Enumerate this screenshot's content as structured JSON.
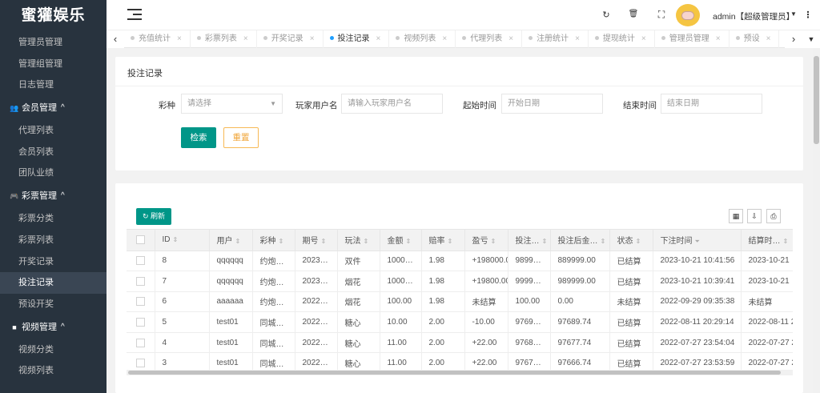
{
  "app": {
    "logo": "蜜獾娱乐"
  },
  "sidebar": {
    "items": [
      {
        "type": "item",
        "label": "管理员管理"
      },
      {
        "type": "item",
        "label": "管理组管理"
      },
      {
        "type": "item",
        "label": "日志管理"
      },
      {
        "type": "group",
        "label": "会员管理",
        "icon": "users-icon",
        "glyph": "👥"
      },
      {
        "type": "item",
        "label": "代理列表"
      },
      {
        "type": "item",
        "label": "会员列表"
      },
      {
        "type": "item",
        "label": "团队业绩"
      },
      {
        "type": "group",
        "label": "彩票管理",
        "icon": "gamepad-icon",
        "glyph": "🎮"
      },
      {
        "type": "item",
        "label": "彩票分类"
      },
      {
        "type": "item",
        "label": "彩票列表"
      },
      {
        "type": "item",
        "label": "开奖记录"
      },
      {
        "type": "item",
        "label": "投注记录",
        "active": true
      },
      {
        "type": "item",
        "label": "预设开奖"
      },
      {
        "type": "group",
        "label": "视频管理",
        "icon": "video-icon",
        "glyph": "■"
      },
      {
        "type": "item",
        "label": "视频分类"
      },
      {
        "type": "item",
        "label": "视频列表"
      }
    ]
  },
  "header": {
    "user": "admin【超级管理员】",
    "icons": [
      "refresh-icon",
      "trash-icon",
      "fullscreen-icon",
      "dropdown-icon",
      "more-icon"
    ]
  },
  "tabs": [
    {
      "label": "充值统计"
    },
    {
      "label": "彩票列表"
    },
    {
      "label": "开奖记录"
    },
    {
      "label": "投注记录",
      "active": true
    },
    {
      "label": "视频列表"
    },
    {
      "label": "代理列表"
    },
    {
      "label": "注册统计"
    },
    {
      "label": "提现统计"
    },
    {
      "label": "管理员管理"
    },
    {
      "label": "预设"
    }
  ],
  "filter": {
    "title": "投注记录",
    "lottery_label": "彩种",
    "lottery_placeholder": "请选择",
    "player_label": "玩家用户名",
    "player_placeholder": "请输入玩家用户名",
    "start_label": "起始时间",
    "start_placeholder": "开始日期",
    "end_label": "结束时间",
    "end_placeholder": "结束日期",
    "search_button": "检索",
    "reset_button": "重置"
  },
  "table": {
    "refresh_label": "刷新",
    "columns": [
      "ID",
      "用户",
      "彩种",
      "期号",
      "玩法",
      "金额",
      "赔率",
      "盈亏",
      "投注…",
      "投注后金…",
      "状态",
      "下注时间",
      "结算时…"
    ],
    "rows": [
      {
        "id": "8",
        "user": "qqqqqq",
        "lottery": "约炮…",
        "issue": "2023…",
        "play": "双件",
        "amount": "1000…",
        "odds": "1.98",
        "profit": "+198000.0",
        "profit_color": "green",
        "before": "9899…",
        "after": "889999.00",
        "status": "已结算",
        "status_color": "green",
        "bet_time": "2023-10-21 10:41:56",
        "settle_time": "2023-10-21",
        "settle_color": "green"
      },
      {
        "id": "7",
        "user": "qqqqqq",
        "lottery": "约炮…",
        "issue": "2023…",
        "play": "烟花",
        "amount": "1000…",
        "odds": "1.98",
        "profit": "+19800.00",
        "profit_color": "green",
        "before": "9999…",
        "after": "989999.00",
        "status": "已结算",
        "status_color": "green",
        "bet_time": "2023-10-21 10:39:41",
        "settle_time": "2023-10-21",
        "settle_color": "green"
      },
      {
        "id": "6",
        "user": "aaaaaa",
        "lottery": "约炮…",
        "issue": "2022…",
        "play": "烟花",
        "amount": "100.00",
        "odds": "1.98",
        "profit": "未结算",
        "profit_color": "red",
        "before": "100.00",
        "after": "0.00",
        "status": "未结算",
        "status_color": "red",
        "bet_time": "2022-09-29 09:35:38",
        "settle_time": "未结算",
        "settle_color": "red"
      },
      {
        "id": "5",
        "user": "test01",
        "lottery": "同城…",
        "issue": "2022…",
        "play": "糖心",
        "amount": "10.00",
        "odds": "2.00",
        "profit": "-10.00",
        "profit_color": "red",
        "before": "9769…",
        "after": "97689.74",
        "status": "已结算",
        "status_color": "green",
        "bet_time": "2022-08-11 20:29:14",
        "settle_time": "2022-08-11 2",
        "settle_color": "green"
      },
      {
        "id": "4",
        "user": "test01",
        "lottery": "同城…",
        "issue": "2022…",
        "play": "糖心",
        "amount": "11.00",
        "odds": "2.00",
        "profit": "+22.00",
        "profit_color": "green",
        "before": "9768…",
        "after": "97677.74",
        "status": "已结算",
        "status_color": "green",
        "bet_time": "2022-07-27 23:54:04",
        "settle_time": "2022-07-27 2",
        "settle_color": "green"
      },
      {
        "id": "3",
        "user": "test01",
        "lottery": "同城…",
        "issue": "2022…",
        "play": "糖心",
        "amount": "11.00",
        "odds": "2.00",
        "profit": "+22.00",
        "profit_color": "green",
        "before": "9767…",
        "after": "97666.74",
        "status": "已结算",
        "status_color": "green",
        "bet_time": "2022-07-27 23:53:59",
        "settle_time": "2022-07-27 2",
        "settle_color": "green"
      }
    ]
  },
  "colors": {
    "sidebar_bg": "#28333e",
    "primary": "#009688",
    "warn": "#f7b955",
    "positive": "#2e9c2e",
    "negative": "#e02020",
    "active_tab_dot": "#1e9fff"
  }
}
